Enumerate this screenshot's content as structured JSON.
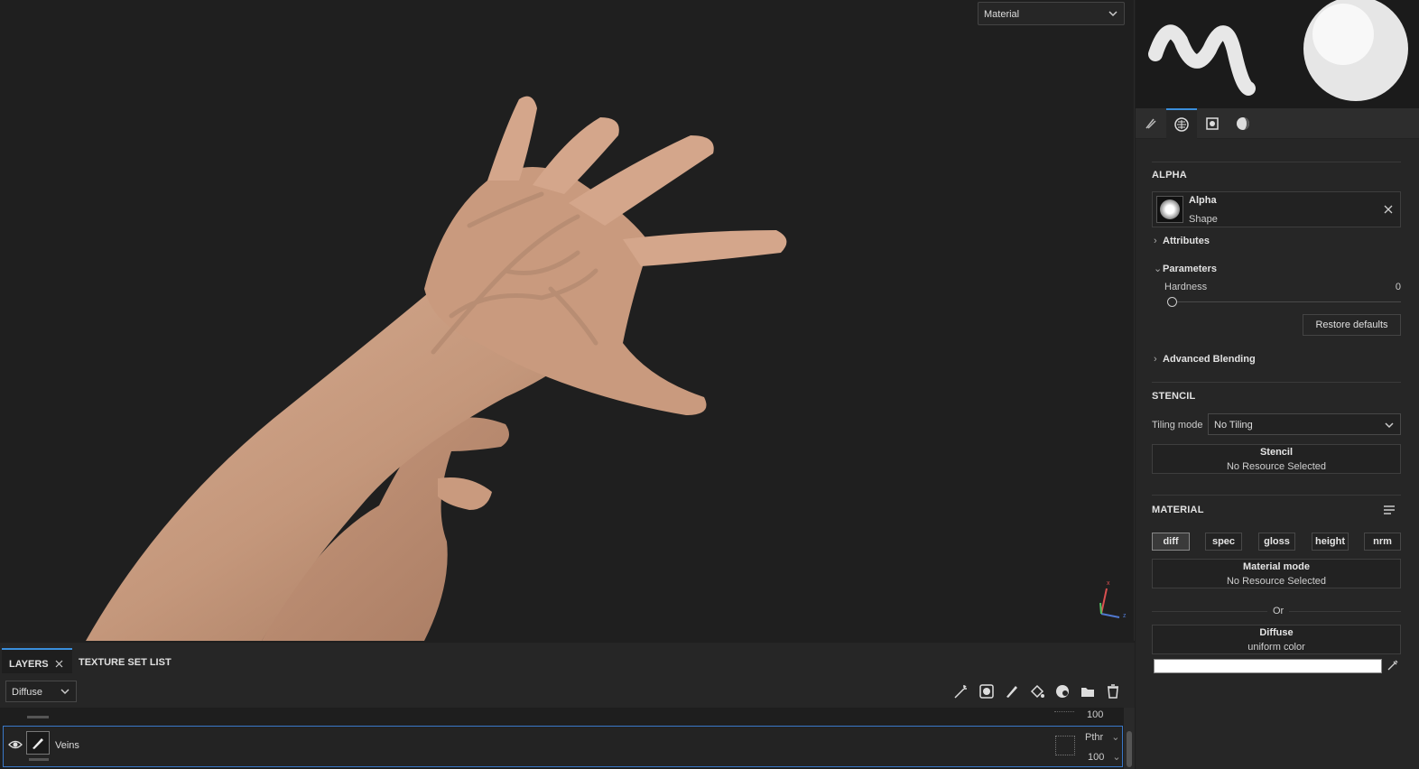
{
  "viewport": {
    "mode_select": "Material"
  },
  "right_panel": {
    "alpha": {
      "section_title": "ALPHA",
      "resource_title": "Alpha",
      "resource_sub": "Shape",
      "attributes_label": "Attributes",
      "parameters_label": "Parameters",
      "hardness_label": "Hardness",
      "hardness_value": "0",
      "hardness_fraction": 0,
      "restore_defaults": "Restore defaults",
      "advanced_blending": "Advanced Blending"
    },
    "stencil": {
      "section_title": "STENCIL",
      "tiling_label": "Tiling mode",
      "tiling_value": "No Tiling",
      "resource_title": "Stencil",
      "resource_sub": "No Resource Selected"
    },
    "material": {
      "section_title": "MATERIAL",
      "channels": [
        "diff",
        "spec",
        "gloss",
        "height",
        "nrm"
      ],
      "active_channel": "diff",
      "mode_title": "Material mode",
      "mode_sub": "No Resource Selected",
      "or_label": "Or",
      "diffuse_title": "Diffuse",
      "diffuse_sub": "uniform color",
      "diffuse_color": "#ffffff"
    }
  },
  "layers": {
    "tabs": [
      "LAYERS",
      "TEXTURE SET LIST"
    ],
    "channel_select": "Diffuse",
    "prev_row_opacity": "100",
    "layer": {
      "name": "Veins",
      "blend": "Pthr",
      "opacity": "100"
    }
  },
  "colors": {
    "accent": "#3a8edb",
    "skin": "#c99a7e",
    "background": "#1f1f1f"
  }
}
